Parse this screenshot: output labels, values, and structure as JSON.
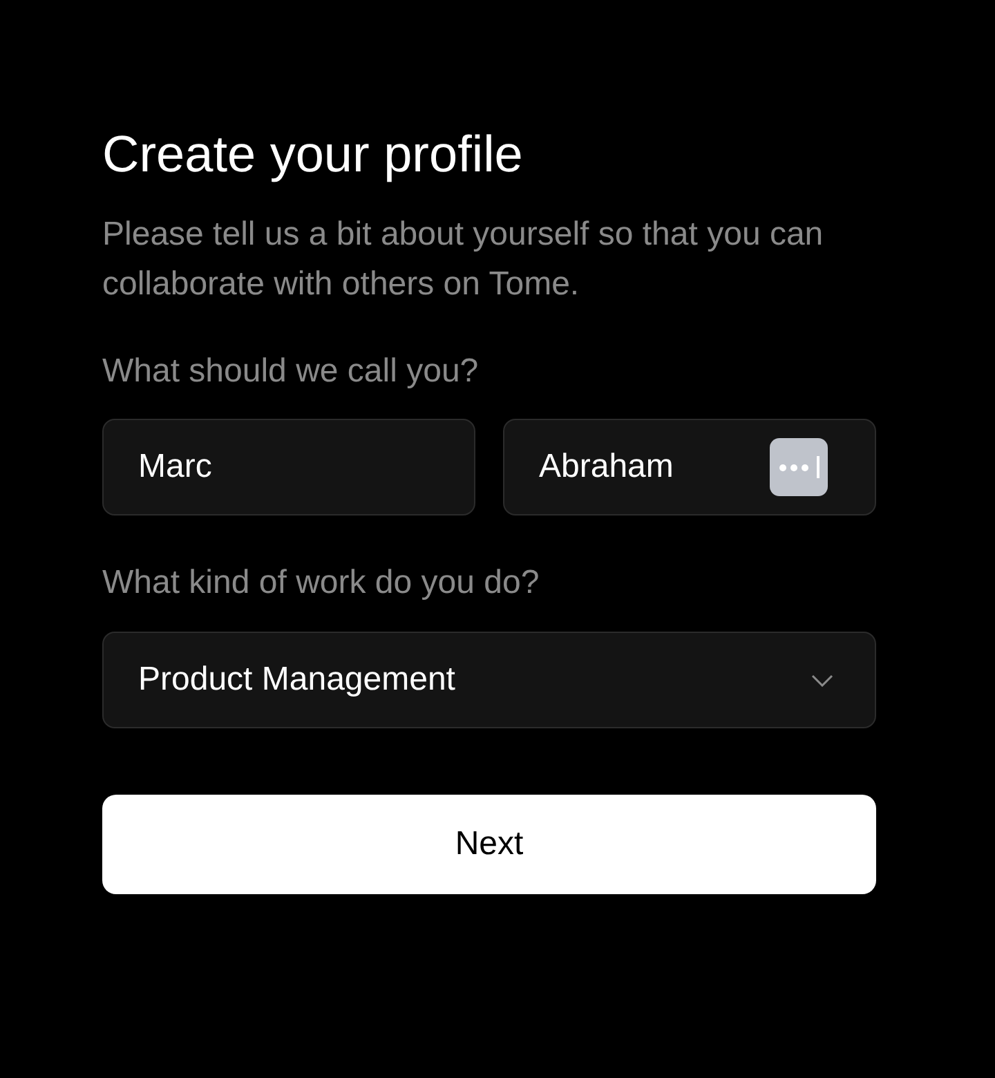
{
  "title": "Create your profile",
  "subtitle": "Please tell us a bit about yourself so that you can collaborate with others on Tome.",
  "name_section": {
    "label": "What should we call you?",
    "first_name": {
      "value": "Marc"
    },
    "last_name": {
      "value": "Abraham",
      "autofill_icon": true
    }
  },
  "work_section": {
    "label": "What kind of work do you do?",
    "select": {
      "value": "Product Management"
    }
  },
  "button": {
    "label": "Next"
  }
}
